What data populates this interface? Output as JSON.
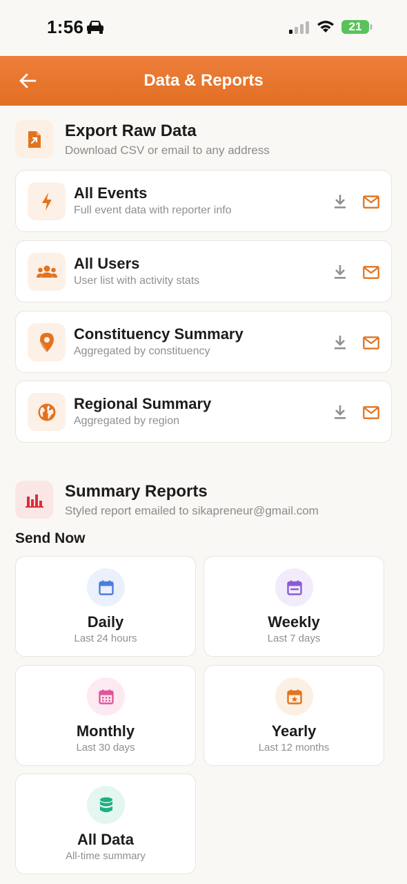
{
  "status_bar": {
    "time": "1:56",
    "battery": "21"
  },
  "header": {
    "title": "Data & Reports"
  },
  "export_section": {
    "title": "Export Raw Data",
    "subtitle": "Download CSV or email to any address",
    "items": [
      {
        "title": "All Events",
        "subtitle": "Full event data with reporter info",
        "icon": "bolt-icon"
      },
      {
        "title": "All Users",
        "subtitle": "User list with activity stats",
        "icon": "users-icon"
      },
      {
        "title": "Constituency Summary",
        "subtitle": "Aggregated by constituency",
        "icon": "map-pin-icon"
      },
      {
        "title": "Regional Summary",
        "subtitle": "Aggregated by region",
        "icon": "globe-icon"
      }
    ]
  },
  "summary_section": {
    "title": "Summary Reports",
    "subtitle": "Styled report emailed to sikapreneur@gmail.com",
    "send_now_label": "Send Now",
    "reports": [
      {
        "title": "Daily",
        "subtitle": "Last 24 hours",
        "icon": "calendar-icon",
        "color": "#4a7de0",
        "bg": "#eaf0fc"
      },
      {
        "title": "Weekly",
        "subtitle": "Last 7 days",
        "icon": "calendar-week-icon",
        "color": "#8a5ad6",
        "bg": "#f1ebfb"
      },
      {
        "title": "Monthly",
        "subtitle": "Last 30 days",
        "icon": "calendar-month-icon",
        "color": "#e0559a",
        "bg": "#fce9f2"
      },
      {
        "title": "Yearly",
        "subtitle": "Last 12 months",
        "icon": "calendar-star-icon",
        "color": "#e2731f",
        "bg": "#fcefe4"
      },
      {
        "title": "All Data",
        "subtitle": "All-time summary",
        "icon": "database-icon",
        "color": "#1fae82",
        "bg": "#e3f6ef"
      }
    ]
  },
  "colors": {
    "accent": "#e2731f",
    "header_bg": "#e9782f",
    "page_bg": "#f9f8f4"
  }
}
